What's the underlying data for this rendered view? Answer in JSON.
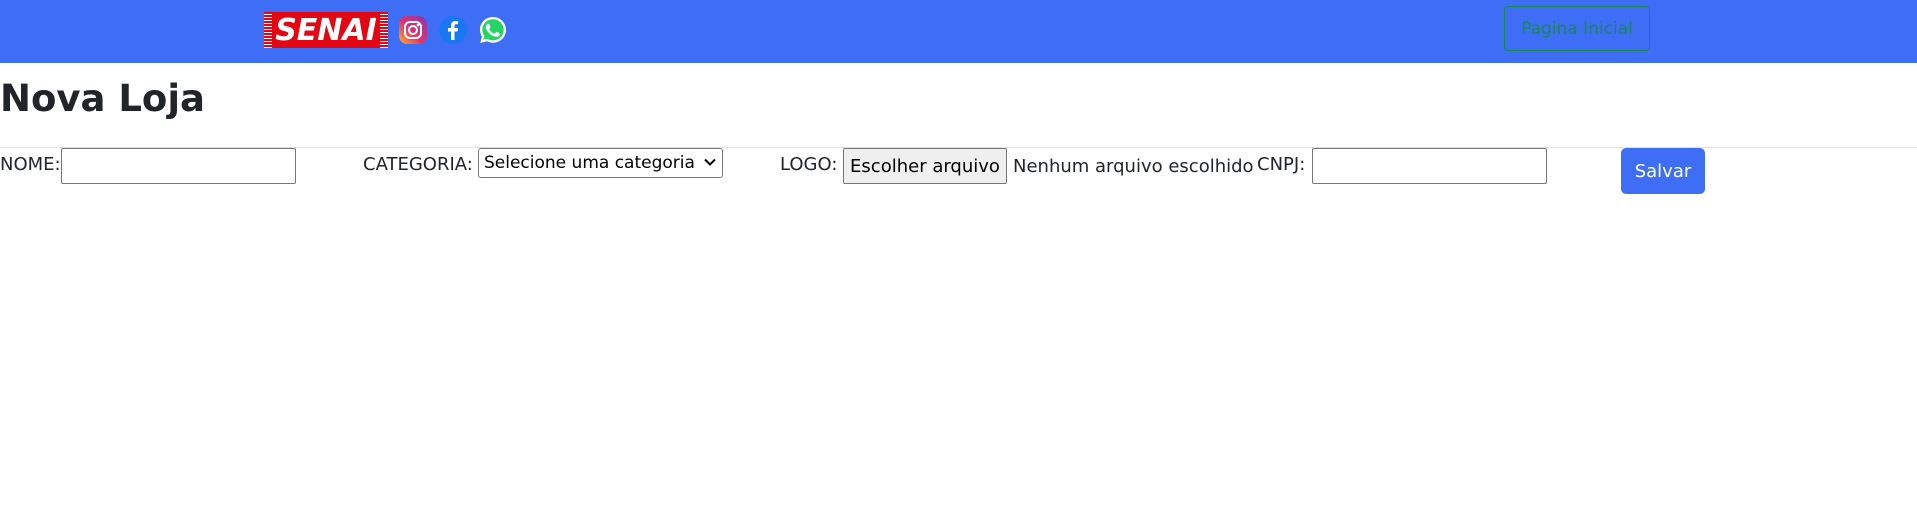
{
  "navbar": {
    "brand_text": "SENAI",
    "icons": [
      "instagram-icon",
      "facebook-icon",
      "whatsapp-icon"
    ],
    "home_button_label": "Pagina Inicial",
    "background_color": "#3e6ef5",
    "home_button_color": "#198754"
  },
  "page": {
    "title": "Nova Loja"
  },
  "form": {
    "nome_label": "NOME:",
    "nome_value": "",
    "categoria_label": "CATEGORIA:",
    "categoria_selected": "Selecione uma categoria",
    "logo_label": "LOGO:",
    "file_button_label": "Escolher arquivo",
    "file_status": "Nenhum arquivo escolhido",
    "cnpj_label": "CNPJ:",
    "cnpj_value": "",
    "save_label": "Salvar",
    "save_color": "#3e6ef5"
  }
}
